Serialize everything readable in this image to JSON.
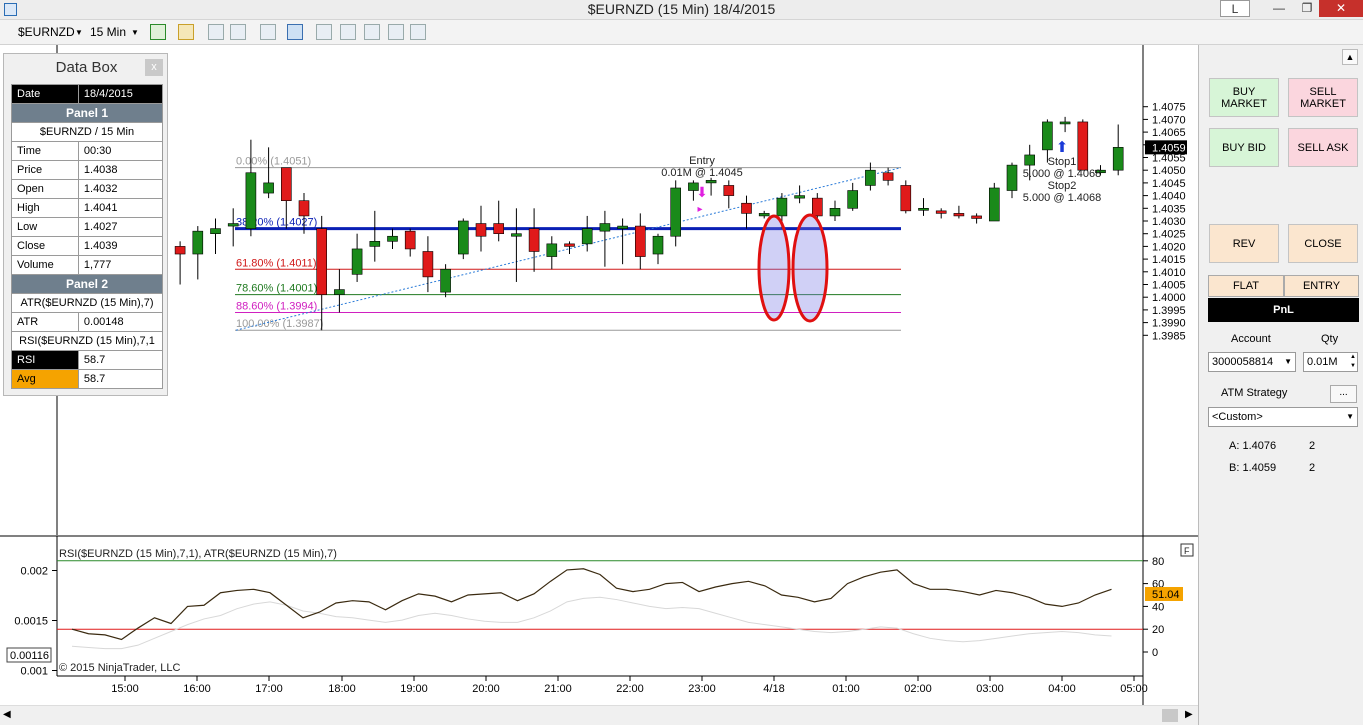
{
  "window": {
    "title": "$EURNZD (15 Min)  18/4/2015",
    "badge": "L",
    "min_label": "—",
    "max_label": "❐",
    "close_label": "✕"
  },
  "toolbar": {
    "instrument": "$EURNZD",
    "interval": "15 Min"
  },
  "databox": {
    "title": "Data Box",
    "close_label": "x",
    "date_label": "Date",
    "date_value": "18/4/2015",
    "panel1": "Panel 1",
    "series": "$EURNZD / 15 Min",
    "rows": [
      {
        "label": "Time",
        "value": "00:30"
      },
      {
        "label": "Price",
        "value": "1.4038"
      },
      {
        "label": "Open",
        "value": "1.4032"
      },
      {
        "label": "High",
        "value": "1.4041"
      },
      {
        "label": "Low",
        "value": "1.4027"
      },
      {
        "label": "Close",
        "value": "1.4039"
      },
      {
        "label": "Volume",
        "value": "1,777"
      }
    ],
    "panel2": "Panel 2",
    "atr_series": "ATR($EURNZD (15 Min),7)",
    "atr_label": "ATR",
    "atr_value": "0.00148",
    "rsi_series": "RSI($EURNZD (15 Min),7,1",
    "rsi_label": "RSI",
    "rsi_value": "58.7",
    "avg_label": "Avg",
    "avg_value": "58.7"
  },
  "chart_data": [
    {
      "type": "candlestick",
      "title": "$EURNZD (15 Min)",
      "ylim": [
        1.3982,
        1.4078
      ],
      "y_ticks": [
        "1.4075",
        "1.4070",
        "1.4065",
        "1.4060",
        "1.4055",
        "1.4050",
        "1.4045",
        "1.4040",
        "1.4035",
        "1.4030",
        "1.4025",
        "1.4020",
        "1.4015",
        "1.4010",
        "1.4005",
        "1.4000",
        "1.3995",
        "1.3990",
        "1.3985"
      ],
      "current_price": "1.4059",
      "candles": [
        {
          "o": 1.4009,
          "h": 1.4012,
          "l": 1.4001,
          "c": 1.4007
        },
        {
          "o": 1.4011,
          "h": 1.4012,
          "l": 1.4009,
          "c": 1.4011
        },
        {
          "o": 1.4033,
          "h": 1.4034,
          "l": 1.4001,
          "c": 1.4021
        },
        {
          "o": 1.402,
          "h": 1.4022,
          "l": 1.4005,
          "c": 1.4017
        },
        {
          "o": 1.4017,
          "h": 1.4028,
          "l": 1.4007,
          "c": 1.4026
        },
        {
          "o": 1.4025,
          "h": 1.4031,
          "l": 1.4017,
          "c": 1.4027
        },
        {
          "o": 1.4028,
          "h": 1.4035,
          "l": 1.402,
          "c": 1.4029
        },
        {
          "o": 1.4027,
          "h": 1.4062,
          "l": 1.4024,
          "c": 1.4049
        },
        {
          "o": 1.4041,
          "h": 1.4059,
          "l": 1.4039,
          "c": 1.4045
        },
        {
          "o": 1.4051,
          "h": 1.4051,
          "l": 1.4027,
          "c": 1.4038
        },
        {
          "o": 1.4038,
          "h": 1.4041,
          "l": 1.4025,
          "c": 1.4032
        },
        {
          "o": 1.4027,
          "h": 1.4032,
          "l": 1.3987,
          "c": 1.4001
        },
        {
          "o": 1.4001,
          "h": 1.4011,
          "l": 1.3994,
          "c": 1.4003
        },
        {
          "o": 1.4009,
          "h": 1.4025,
          "l": 1.4006,
          "c": 1.4019
        },
        {
          "o": 1.402,
          "h": 1.4034,
          "l": 1.4014,
          "c": 1.4022
        },
        {
          "o": 1.4022,
          "h": 1.4027,
          "l": 1.4019,
          "c": 1.4024
        },
        {
          "o": 1.4026,
          "h": 1.4027,
          "l": 1.4016,
          "c": 1.4019
        },
        {
          "o": 1.4018,
          "h": 1.4024,
          "l": 1.4002,
          "c": 1.4008
        },
        {
          "o": 1.4002,
          "h": 1.4013,
          "l": 1.4,
          "c": 1.4011
        },
        {
          "o": 1.4017,
          "h": 1.4031,
          "l": 1.4015,
          "c": 1.403
        },
        {
          "o": 1.4029,
          "h": 1.4036,
          "l": 1.4018,
          "c": 1.4024
        },
        {
          "o": 1.4029,
          "h": 1.4038,
          "l": 1.4022,
          "c": 1.4025
        },
        {
          "o": 1.4024,
          "h": 1.4035,
          "l": 1.4006,
          "c": 1.4025
        },
        {
          "o": 1.4027,
          "h": 1.4035,
          "l": 1.401,
          "c": 1.4018
        },
        {
          "o": 1.4016,
          "h": 1.4024,
          "l": 1.4011,
          "c": 1.4021
        },
        {
          "o": 1.4021,
          "h": 1.4022,
          "l": 1.4017,
          "c": 1.402
        },
        {
          "o": 1.4021,
          "h": 1.4032,
          "l": 1.4018,
          "c": 1.4027
        },
        {
          "o": 1.4026,
          "h": 1.4034,
          "l": 1.4012,
          "c": 1.4029
        },
        {
          "o": 1.4027,
          "h": 1.4031,
          "l": 1.4013,
          "c": 1.4028
        },
        {
          "o": 1.4028,
          "h": 1.4033,
          "l": 1.4011,
          "c": 1.4016
        },
        {
          "o": 1.4017,
          "h": 1.4025,
          "l": 1.4013,
          "c": 1.4024
        },
        {
          "o": 1.4024,
          "h": 1.4046,
          "l": 1.402,
          "c": 1.4043
        },
        {
          "o": 1.4042,
          "h": 1.4046,
          "l": 1.4038,
          "c": 1.4045
        },
        {
          "o": 1.4045,
          "h": 1.4047,
          "l": 1.404,
          "c": 1.4046
        },
        {
          "o": 1.4044,
          "h": 1.4046,
          "l": 1.4035,
          "c": 1.404
        },
        {
          "o": 1.4037,
          "h": 1.404,
          "l": 1.4027,
          "c": 1.4033
        },
        {
          "o": 1.4032,
          "h": 1.4034,
          "l": 1.4031,
          "c": 1.4033
        },
        {
          "o": 1.4032,
          "h": 1.4041,
          "l": 1.4027,
          "c": 1.4039
        },
        {
          "o": 1.4039,
          "h": 1.4044,
          "l": 1.4037,
          "c": 1.404
        },
        {
          "o": 1.4039,
          "h": 1.4041,
          "l": 1.403,
          "c": 1.4032
        },
        {
          "o": 1.4032,
          "h": 1.4038,
          "l": 1.403,
          "c": 1.4035
        },
        {
          "o": 1.4035,
          "h": 1.4045,
          "l": 1.4034,
          "c": 1.4042
        },
        {
          "o": 1.4044,
          "h": 1.4053,
          "l": 1.4042,
          "c": 1.405
        },
        {
          "o": 1.4049,
          "h": 1.4051,
          "l": 1.4044,
          "c": 1.4046
        },
        {
          "o": 1.4044,
          "h": 1.4046,
          "l": 1.4033,
          "c": 1.4034
        },
        {
          "o": 1.4035,
          "h": 1.4039,
          "l": 1.4032,
          "c": 1.4035
        },
        {
          "o": 1.4034,
          "h": 1.4035,
          "l": 1.4031,
          "c": 1.4033
        },
        {
          "o": 1.4033,
          "h": 1.4036,
          "l": 1.4031,
          "c": 1.4032
        },
        {
          "o": 1.4032,
          "h": 1.4033,
          "l": 1.4029,
          "c": 1.4031
        },
        {
          "o": 1.403,
          "h": 1.4045,
          "l": 1.403,
          "c": 1.4043
        },
        {
          "o": 1.4042,
          "h": 1.4053,
          "l": 1.4039,
          "c": 1.4052
        },
        {
          "o": 1.4052,
          "h": 1.406,
          "l": 1.4046,
          "c": 1.4056
        },
        {
          "o": 1.4058,
          "h": 1.407,
          "l": 1.4053,
          "c": 1.4069
        },
        {
          "o": 1.4069,
          "h": 1.4071,
          "l": 1.4065,
          "c": 1.4069
        },
        {
          "o": 1.4069,
          "h": 1.407,
          "l": 1.4053,
          "c": 1.405
        },
        {
          "o": 1.4049,
          "h": 1.4052,
          "l": 1.4048,
          "c": 1.405
        },
        {
          "o": 1.405,
          "h": 1.4068,
          "l": 1.4048,
          "c": 1.4059
        }
      ],
      "fib_levels": [
        {
          "label": "0.00% (1.4051)",
          "price": 1.4051,
          "color": "#9a9a9a"
        },
        {
          "label": "38.20% (1.4027)",
          "price": 1.4027,
          "color": "#0a1fb4"
        },
        {
          "label": "61.80% (1.4011)",
          "price": 1.4011,
          "color": "#d01818"
        },
        {
          "label": "78.60% (1.4001)",
          "price": 1.4001,
          "color": "#207a20"
        },
        {
          "label": "88.60% (1.3994)",
          "price": 1.3994,
          "color": "#d020c0"
        },
        {
          "label": "100.00% (1.3987)",
          "price": 1.3987,
          "color": "#9a9a9a"
        }
      ],
      "orders": {
        "entry_label": "Entry",
        "entry_detail": "0.01M @ 1.4045",
        "stop1_label": "Stop1",
        "stop1_detail": "5.000 @ 1.4068",
        "stop2_label": "Stop2",
        "stop2_detail": "5.000 @ 1.4068"
      }
    },
    {
      "type": "line",
      "title": "RSI($EURNZD (15 Min),7,1), ATR($EURNZD (15 Min),7)",
      "left_ticks": [
        "0.002",
        "0.0015",
        "0.001"
      ],
      "right_ticks": [
        "80",
        "60",
        "40",
        "20",
        "0"
      ],
      "left_value_label": "0.00116",
      "right_value_label": "51.04",
      "rsi_upper": 80,
      "rsi_lower": 20,
      "series": [
        {
          "values": [
            20,
            16,
            15,
            11,
            21,
            30,
            25,
            40,
            41,
            52,
            54,
            55,
            52,
            41,
            30,
            35,
            43,
            45,
            44,
            37,
            45,
            51,
            49,
            44,
            50,
            51,
            52,
            45,
            51,
            62,
            72,
            73,
            68,
            56,
            53,
            55,
            60,
            61,
            53,
            57,
            60,
            62,
            58,
            50,
            48,
            44,
            47,
            60,
            66,
            70,
            72,
            60,
            55,
            55,
            53,
            50,
            54,
            52,
            48,
            42,
            40,
            43,
            50,
            55
          ]
        },
        {
          "values": [
            5,
            4,
            3,
            3,
            6,
            12,
            18,
            24,
            29,
            32,
            38,
            42,
            44,
            41,
            36,
            34,
            31,
            30,
            28,
            26,
            28,
            32,
            34,
            32,
            29,
            27,
            26,
            26,
            30,
            36,
            44,
            47,
            48,
            46,
            43,
            40,
            38,
            39,
            38,
            34,
            30,
            26,
            24,
            22,
            20,
            18,
            17,
            18,
            20,
            22,
            21,
            16,
            12,
            10,
            9,
            10,
            12,
            14,
            16,
            17,
            18,
            17,
            15,
            14
          ]
        }
      ],
      "x_labels": [
        "15:00",
        "16:00",
        "17:00",
        "18:00",
        "19:00",
        "20:00",
        "21:00",
        "22:00",
        "23:00",
        "4/18",
        "01:00",
        "02:00",
        "03:00",
        "04:00",
        "05:00"
      ],
      "copyright": "© 2015 NinjaTrader, LLC"
    }
  ],
  "rightpanel": {
    "buy_market": "BUY MARKET",
    "sell_market": "SELL MARKET",
    "buy_bid": "BUY BID",
    "sell_ask": "SELL ASK",
    "rev": "REV",
    "close": "CLOSE",
    "flat": "FLAT",
    "entry": "ENTRY",
    "pnl": "PnL",
    "account_label": "Account",
    "qty_label": "Qty",
    "account_value": "3000058814",
    "qty_value": "0.01M",
    "atm_label": "ATM Strategy",
    "atm_dots": "...",
    "atm_value": "<Custom>",
    "quotes": [
      {
        "label": "A: 1.4076",
        "size": "2"
      },
      {
        "label": "B: 1.4059",
        "size": "2"
      }
    ]
  }
}
